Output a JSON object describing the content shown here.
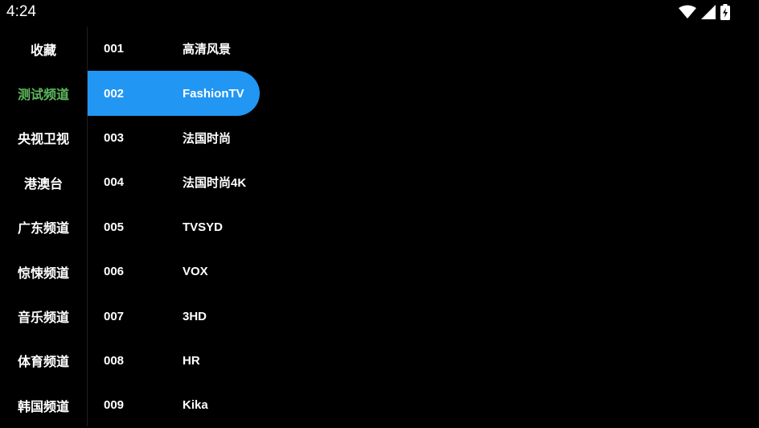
{
  "status_bar": {
    "time": "4:24",
    "icons": [
      "wifi-icon",
      "cellular-signal-icon",
      "battery-charging-icon"
    ]
  },
  "categories": [
    {
      "label": "收藏"
    },
    {
      "label": "测试频道"
    },
    {
      "label": "央视卫视"
    },
    {
      "label": "港澳台"
    },
    {
      "label": "广东频道"
    },
    {
      "label": "惊悚频道"
    },
    {
      "label": "音乐频道"
    },
    {
      "label": "体育频道"
    },
    {
      "label": "韩国频道"
    }
  ],
  "active_category": "测试频道",
  "channels": [
    {
      "number": "001",
      "name": "高清风景"
    },
    {
      "number": "002",
      "name": "FashionTV"
    },
    {
      "number": "003",
      "name": "法国时尚"
    },
    {
      "number": "004",
      "name": "法国时尚4K"
    },
    {
      "number": "005",
      "name": "TVSYD"
    },
    {
      "number": "006",
      "name": "VOX"
    },
    {
      "number": "007",
      "name": "3HD"
    },
    {
      "number": "008",
      "name": "HR"
    },
    {
      "number": "009",
      "name": "Kika"
    }
  ],
  "selected_channel": "002",
  "colors": {
    "background": "#000000",
    "selection": "#2196f3",
    "active_category_text": "#5cb85c",
    "text": "#ffffff"
  }
}
